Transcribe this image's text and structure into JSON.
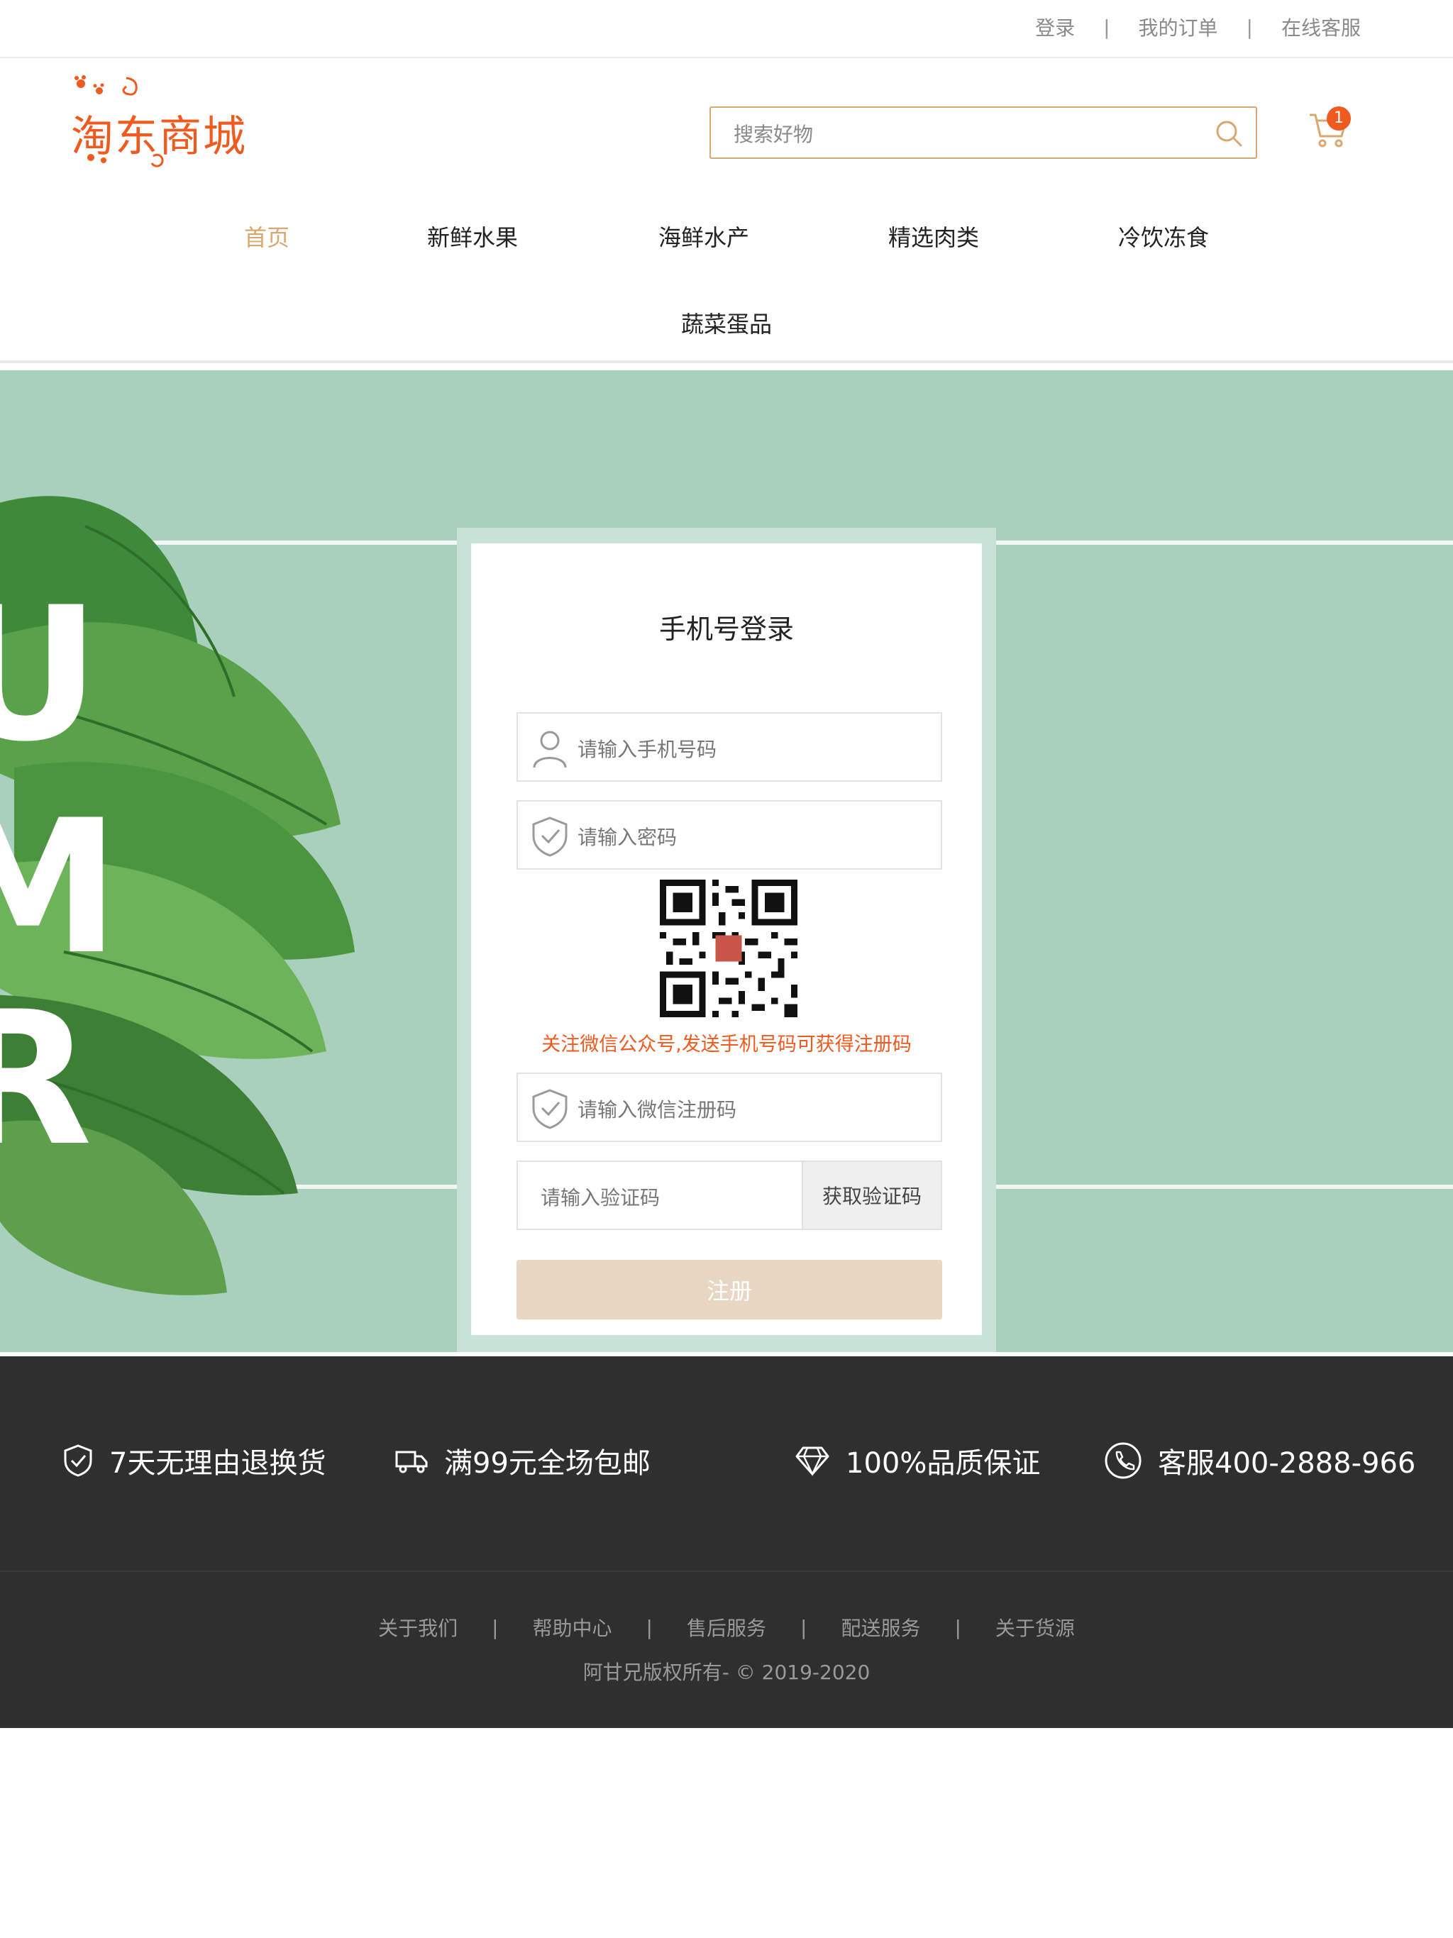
{
  "top_links": [
    "登录",
    "我的订单",
    "在线客服"
  ],
  "logo_text": "淘东商城",
  "search": {
    "placeholder": "搜索好物"
  },
  "cart": {
    "badge": "1"
  },
  "nav": [
    "首页",
    "新鲜水果",
    "海鲜水产",
    "精选肉类",
    "冷饮冻食",
    "蔬菜蛋品"
  ],
  "login": {
    "title": "手机号登录",
    "phone_placeholder": "请输入手机号码",
    "password_placeholder": "请输入密码",
    "wechat_hint": "关注微信公众号,发送手机号码可获得注册码",
    "wechat_code_placeholder": "请输入微信注册码",
    "verify_placeholder": "请输入验证码",
    "get_code_label": "获取验证码",
    "submit_label": "注册"
  },
  "features": [
    "7天无理由退换货",
    "满99元全场包邮",
    "100%品质保证",
    "客服400-2888-966"
  ],
  "footer_links": [
    "关于我们",
    "帮助中心",
    "售后服务",
    "配送服务",
    "关于货源"
  ],
  "copyright": "阿甘兄版权所有- © 2019-2020",
  "colors": {
    "accent_orange": "#f05a1e",
    "gold": "#d9a871",
    "banner_green": "#a8d0bc",
    "footer_bg": "#2f2f2f",
    "submit_bg": "#e8d8c3"
  },
  "icons": [
    "search-icon",
    "cart-icon",
    "user-icon",
    "shield-check-icon",
    "qr-code",
    "truck-icon",
    "diamond-icon",
    "phone-icon"
  ]
}
